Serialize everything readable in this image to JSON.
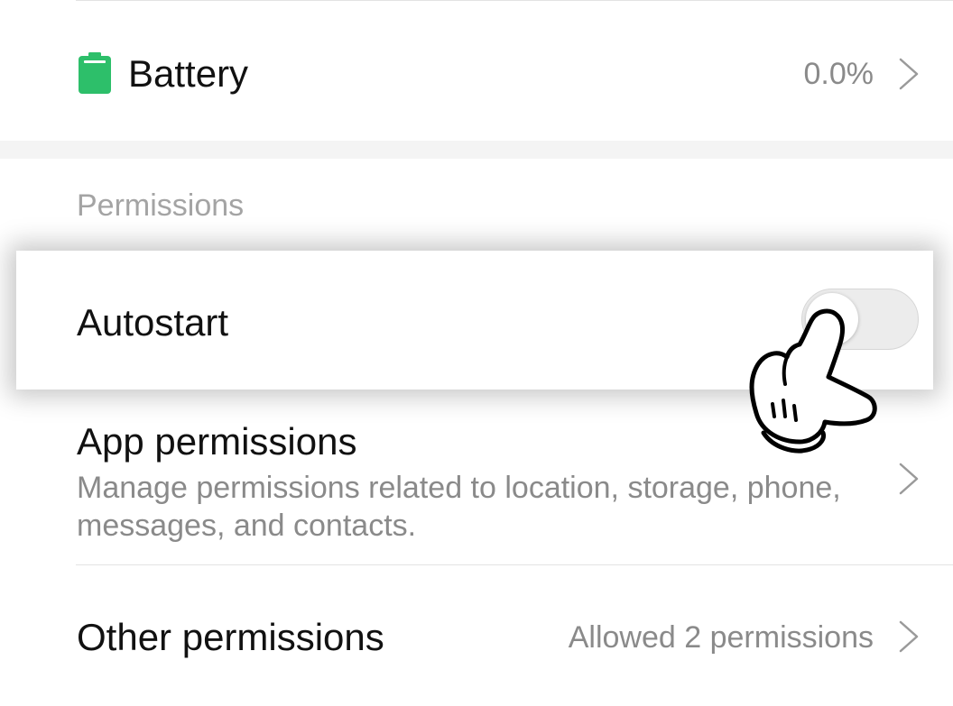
{
  "battery": {
    "label": "Battery",
    "value": "0.0%",
    "icon": "battery-icon",
    "icon_color": "#2dbf6a"
  },
  "permissions_section": {
    "header": "Permissions"
  },
  "autostart": {
    "label": "Autostart",
    "toggle_on": false
  },
  "app_permissions": {
    "title": "App permissions",
    "description": "Manage permissions related to location, storage, phone, messages, and contacts."
  },
  "other_permissions": {
    "title": "Other permissions",
    "value": "Allowed 2 permissions"
  },
  "overlay": {
    "icon": "pointing-hand-icon"
  }
}
